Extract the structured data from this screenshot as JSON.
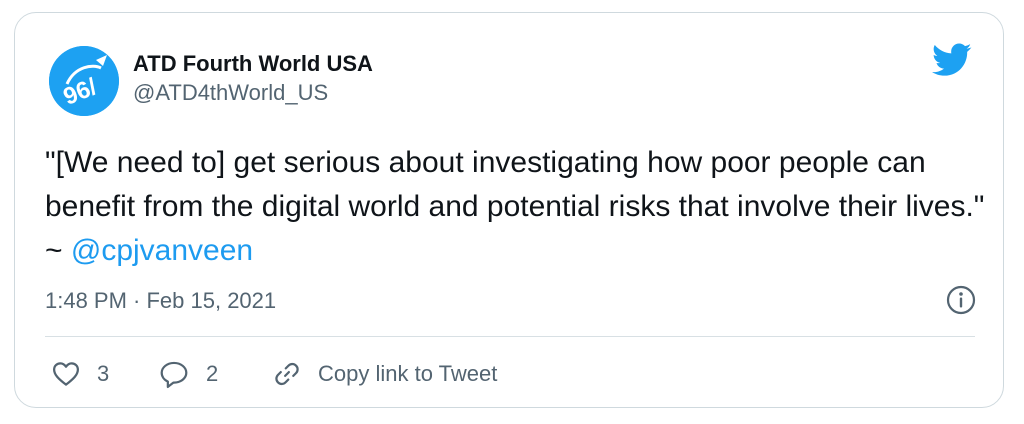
{
  "author": {
    "display_name": "ATD Fourth World USA",
    "handle": "@ATD4thWorld_US",
    "avatar_icon": "atd-fourth-world-logo",
    "avatar_color": "#1da1f2"
  },
  "brand": {
    "icon": "twitter-bird-icon",
    "color": "#1da1f2"
  },
  "tweet": {
    "text_before_mention": "\"[We need to] get serious about investigating how poor people can benefit from the digital world and potential risks that involve their lives.\" ~ ",
    "mention": "@cpjvanveen",
    "timestamp": "1:48 PM · Feb 15, 2021"
  },
  "actions": {
    "like_count": "3",
    "reply_count": "2",
    "copy_link_label": "Copy link to Tweet"
  },
  "colors": {
    "text": "#0f1419",
    "secondary": "#536471",
    "link": "#1d9bf0",
    "border": "#cfd9de"
  }
}
